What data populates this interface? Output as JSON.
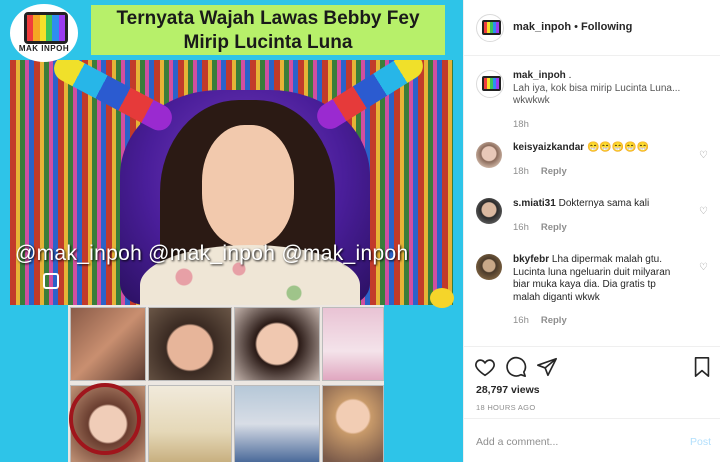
{
  "media": {
    "logo_text": "MAK INPOH",
    "headline_line1": "Ternyata Wajah Lawas Bebby Fey",
    "headline_line2": "Mirip Lucinta Luna",
    "watermark": "@mak_inpoh @mak_inpoh @mak_inpoh"
  },
  "header": {
    "username": "mak_inpoh",
    "separator": " • ",
    "follow_status": "Following"
  },
  "comments": [
    {
      "user": "mak_inpoh",
      "text": " .",
      "text2": "Lah iya, kok bisa mirip Lucinta Luna... wkwkwk",
      "time": "18h",
      "reply": ""
    },
    {
      "user": "keisyaizkandar",
      "text": " 😁😁😁😁😁",
      "time": "18h",
      "reply": "Reply"
    },
    {
      "user": "s.miati31",
      "text": " Dokternya sama kali",
      "time": "16h",
      "reply": "Reply"
    },
    {
      "user": "bkyfebr",
      "text": " Lha dipermak malah gtu. Lucinta luna ngeluarin duit milyaran biar muka kaya dia. Dia gratis tp malah diganti wkwk",
      "time": "16h",
      "reply": "Reply"
    }
  ],
  "actions": {
    "views": "28,797 views",
    "posted_ago": "18 HOURS AGO"
  },
  "add_comment": {
    "placeholder": "Add a comment...",
    "post_label": "Post"
  },
  "colors": {
    "headline_bg": "#b7f06a",
    "media_bg": "#2ec4e8",
    "post_disabled": "#b2dffc"
  }
}
